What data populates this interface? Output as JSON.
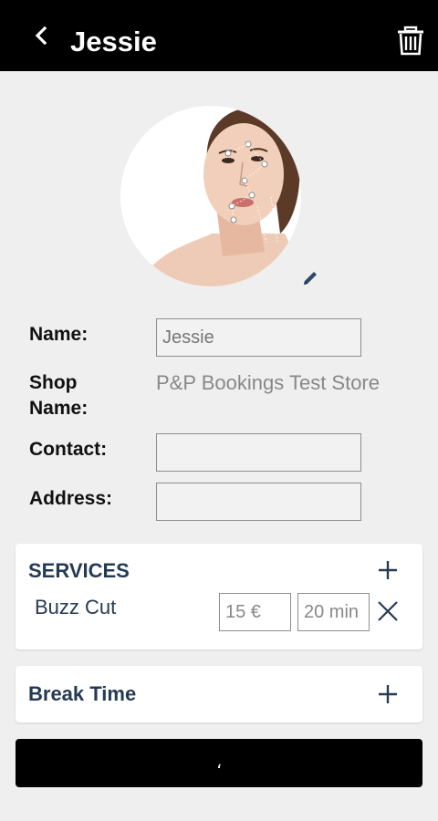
{
  "header": {
    "title": "Jessie"
  },
  "icons": {
    "back": "chevron-left-icon",
    "delete": "trash-icon",
    "edit_photo": "pencil-icon",
    "add": "plus-icon",
    "remove": "close-icon"
  },
  "colors": {
    "topbar": "#000000",
    "background": "#efefef",
    "card_title": "#253a53",
    "pencil": "#2b4a6b"
  },
  "profile": {
    "name_label": "Name:",
    "name_value": "Jessie",
    "shop_label_line1": "Shop",
    "shop_label_line2": "Name:",
    "shop_value": "P&P Bookings Test Store",
    "contact_label": "Contact:",
    "contact_value": "",
    "address_label": "Address:",
    "address_value": ""
  },
  "services": {
    "title": "SERVICES",
    "items": [
      {
        "name": "Buzz Cut",
        "price": "15 €",
        "duration": "20 min"
      }
    ]
  },
  "break_time": {
    "title": "Break Time"
  },
  "save_button": {
    "label": "،"
  }
}
